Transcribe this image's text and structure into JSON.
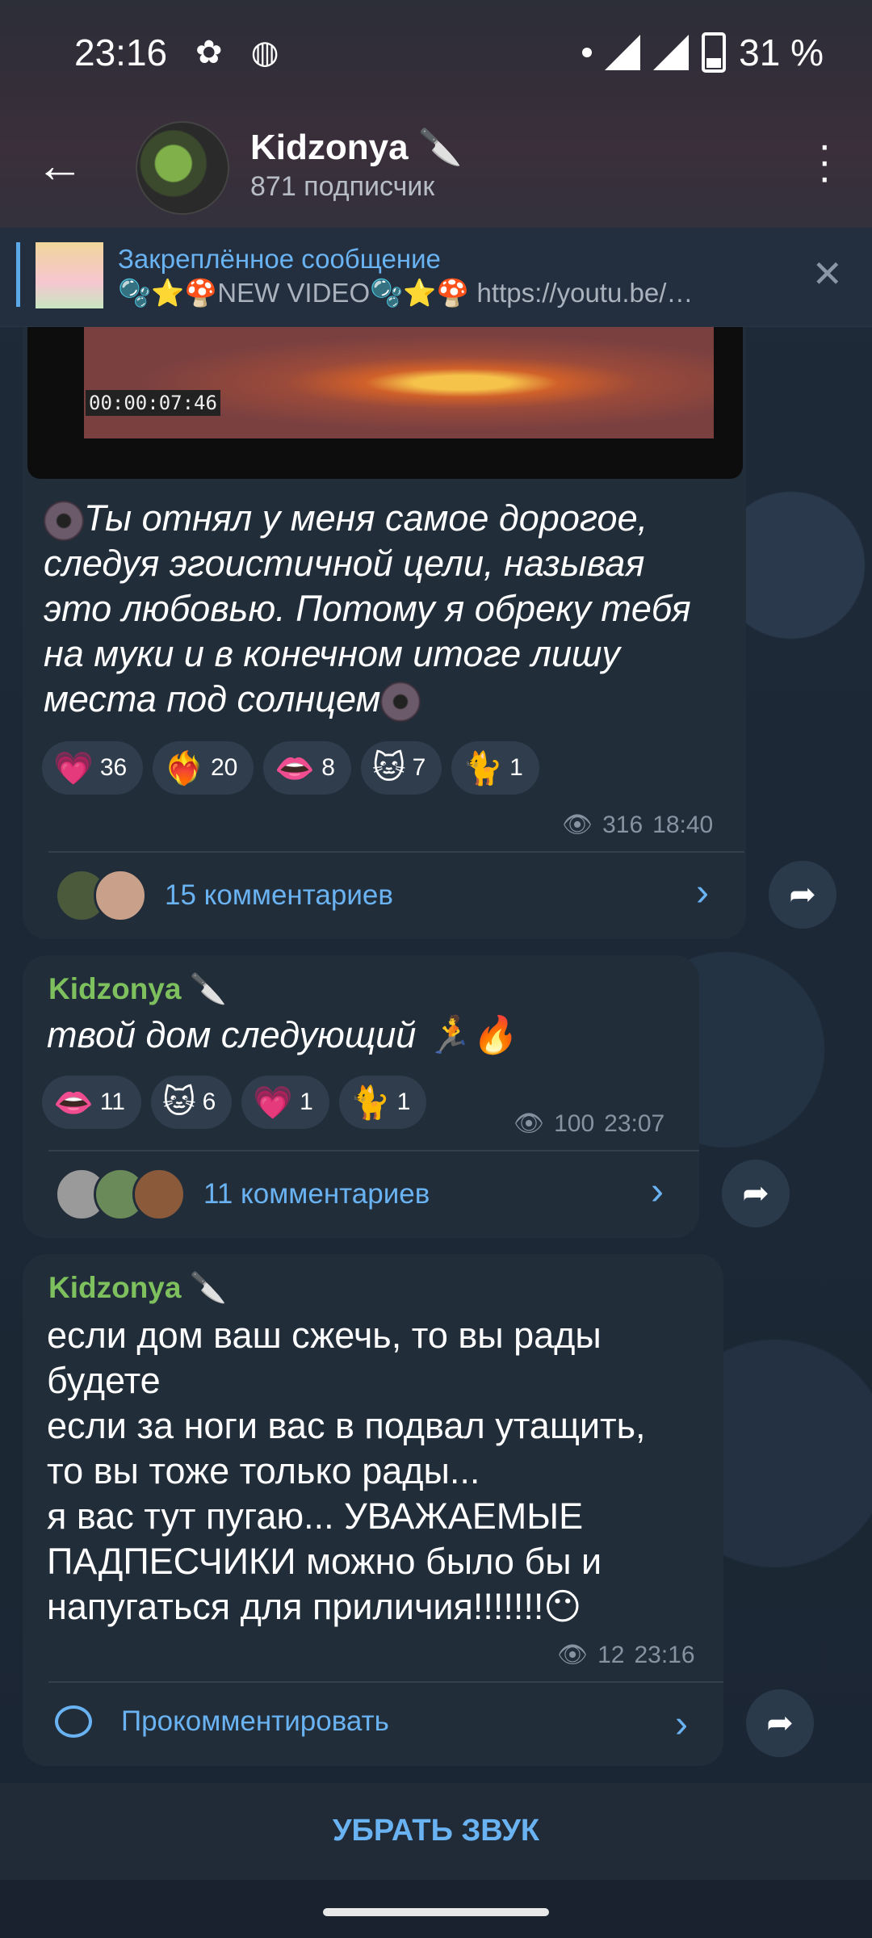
{
  "status_bar": {
    "time": "23:16",
    "battery": "31 %"
  },
  "header": {
    "channel_name": "Kidzonya 🔪",
    "subscribers": "871 подписчик"
  },
  "pinned": {
    "title": "Закреплённое сообщение",
    "text": "🫧⭐🍄NEW VIDEO🫧⭐🍄 https://youtu.be/…"
  },
  "messages": [
    {
      "video_timestamp": "00:00:07:46",
      "text_before": "Ты отнял у меня самое дорогое, следуя эгоистичной цели, называя это любовью. Потому я обреку тебя на муки и в конечном итоге лишу места под солнцем",
      "reactions": [
        {
          "emoji": "💗",
          "count": "36"
        },
        {
          "emoji": "❤️‍🔥",
          "count": "20"
        },
        {
          "emoji": "👄",
          "count": "8"
        },
        {
          "emoji": "🐱",
          "count": "7"
        },
        {
          "emoji": "🐈",
          "count": "1"
        }
      ],
      "views": "316",
      "time": "18:40",
      "comments": "15 комментариев"
    },
    {
      "sender": "Kidzonya 🔪",
      "text": "твой дом следующий 🏃🔥",
      "reactions": [
        {
          "emoji": "👄",
          "count": "11"
        },
        {
          "emoji": "🐱",
          "count": "6"
        },
        {
          "emoji": "💗",
          "count": "1"
        },
        {
          "emoji": "🐈",
          "count": "1"
        }
      ],
      "views": "100",
      "time": "23:07",
      "comments": "11 комментариев"
    },
    {
      "sender": "Kidzonya 🔪",
      "text_lines": [
        "если дом ваш сжечь, то вы рады",
        "будете",
        "если за ноги вас в подвал утащить,",
        "то вы тоже только рады...",
        "я вас тут пугаю... УВАЖАЕМЫЕ",
        "ПАДПЕСЧИКИ можно было бы и",
        "напугаться для приличия!!!!!!!😶"
      ],
      "views": "12",
      "time": "23:16",
      "comment_action": "Прокомментировать"
    }
  ],
  "bottom": {
    "mute_label": "УБРАТЬ ЗВУК"
  },
  "icons": {
    "eye": "👁",
    "back": "←",
    "share": "➦",
    "close": "✕",
    "chevron": "›"
  },
  "colors": {
    "accent": "#6ab3f3",
    "sender": "#7dc05d",
    "bubble": "#222d3a"
  }
}
